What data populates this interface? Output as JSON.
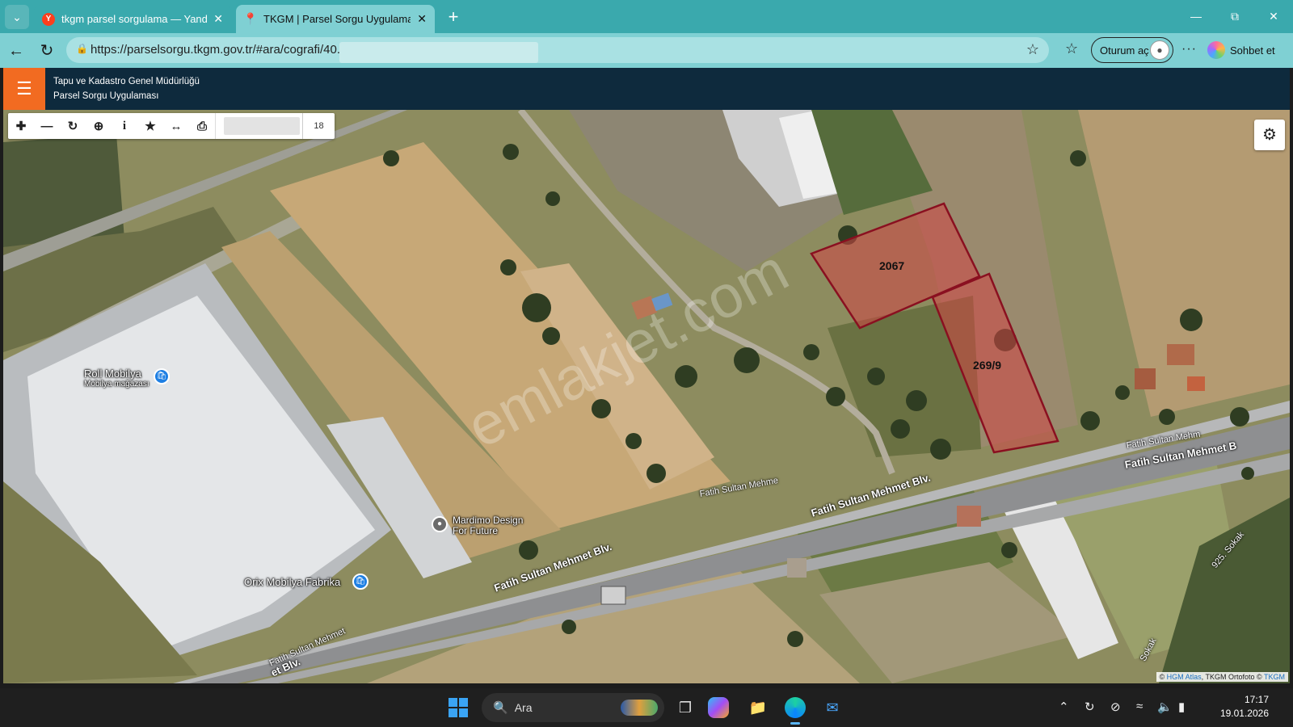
{
  "browser": {
    "tabs": [
      {
        "title": "tkgm parsel sorgulama — Yandex:",
        "favicon": "yandex-icon",
        "active": false
      },
      {
        "title": "TKGM | Parsel Sorgu Uygulaması",
        "favicon": "map-pin-icon",
        "active": true
      }
    ],
    "url": "https://parselsorgu.tkgm.gov.tr/#ara/cografi/40.",
    "login_label": "Oturum aç",
    "chat_label": "Sohbet et"
  },
  "app": {
    "org_name": "Tapu ve Kadastro Genel Müdürlüğü",
    "app_name": "Parsel Sorgu Uygulaması",
    "accent_color": "#f26b21",
    "header_color": "#0e2a3d"
  },
  "map": {
    "zoom_level": "18",
    "parcels": [
      {
        "label": "2067"
      },
      {
        "label": "269/9"
      }
    ],
    "watermark": "emlakjet.com",
    "pois": [
      {
        "name": "Roll Mobilya",
        "sub": "Mobilya mağazası"
      },
      {
        "name": "Mardimo Design",
        "sub": "For Future"
      },
      {
        "name": "Orix Mobilya Fabrika",
        "sub": ""
      }
    ],
    "roads": [
      "Fatih Sultan Mehmet Blv.",
      "Fatih Sultan Mehmet Blv.",
      "Fatih Sultan Mehme",
      "Fatih Sultan Mehmet B",
      "Fatih Sultan Mehm",
      "Fatih Sultan Mehmet",
      "et Blv.",
      "925. Sokak",
      "Sokak"
    ],
    "attribution": {
      "prefix": "© ",
      "atlas": "HGM Atlas",
      "middle": ", TKGM Ortofoto © ",
      "tkgm": "TKGM"
    }
  },
  "taskbar": {
    "search_label": "Ara",
    "time": "17:17",
    "date": "19.01.2026"
  }
}
